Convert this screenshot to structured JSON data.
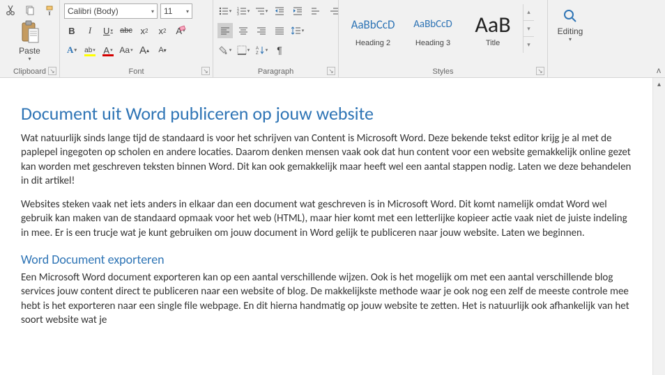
{
  "ribbon": {
    "clipboard": {
      "label": "Clipboard",
      "paste": "Paste"
    },
    "font": {
      "label": "Font",
      "name": "Calibri (Body)",
      "size": "11",
      "bold": "B",
      "italic": "I",
      "underline": "U",
      "strike": "abc",
      "subscript": "x",
      "superscript": "x",
      "textEffects": "A",
      "highlightLetter": "ab",
      "fontColorLetter": "A",
      "caseLetter": "Aa",
      "growLetter": "A",
      "shrinkLetter": "A",
      "clearLetter": "A"
    },
    "paragraph": {
      "label": "Paragraph"
    },
    "styles": {
      "label": "Styles",
      "items": [
        {
          "preview": "AaBbCcD",
          "name": "Heading 2",
          "size": "17px"
        },
        {
          "preview": "AaBbCcD",
          "name": "Heading 3",
          "size": "15px"
        },
        {
          "preview": "AaB",
          "name": "Title",
          "size": "32px"
        }
      ]
    },
    "editing": {
      "label": "Editing"
    }
  },
  "document": {
    "h1": "Document uit Word publiceren op jouw website",
    "p1": "Wat natuurlijk sinds lange tijd de standaard is voor het schrijven van Content is Microsoft Word. Deze bekende tekst editor krijg je al met de paplepel ingegoten op scholen en andere locaties. Daarom denken mensen vaak ook dat hun content voor een website gemakkelijk online gezet kan worden met geschreven teksten binnen Word. Dit kan ook gemakkelijk maar heeft wel een aantal stappen nodig. Laten we deze behandelen in dit artikel!",
    "p2": "Websites steken vaak net iets anders in elkaar dan een document wat geschreven is in Microsoft Word. Dit komt namelijk omdat Word wel gebruik kan maken van de standaard opmaak voor het web (HTML), maar hier komt met een letterlijke kopieer actie vaak niet de juiste indeling in mee. Er is een trucje wat je kunt gebruiken om jouw document in Word gelijk te publiceren naar jouw website. Laten we beginnen.",
    "h2": "Word Document exporteren",
    "p3": "Een Microsoft Word document exporteren kan op een aantal verschillende wijzen. Ook is het mogelijk om met een aantal verschillende blog services jouw content direct te publiceren naar een website of blog. De makkelijkste methode waar je ook nog een zelf de meeste controle mee hebt is het exporteren naar een single file webpage. En dit hierna handmatig op jouw website te zetten. Het is natuurlijk ook afhankelijk van het soort website wat je"
  }
}
